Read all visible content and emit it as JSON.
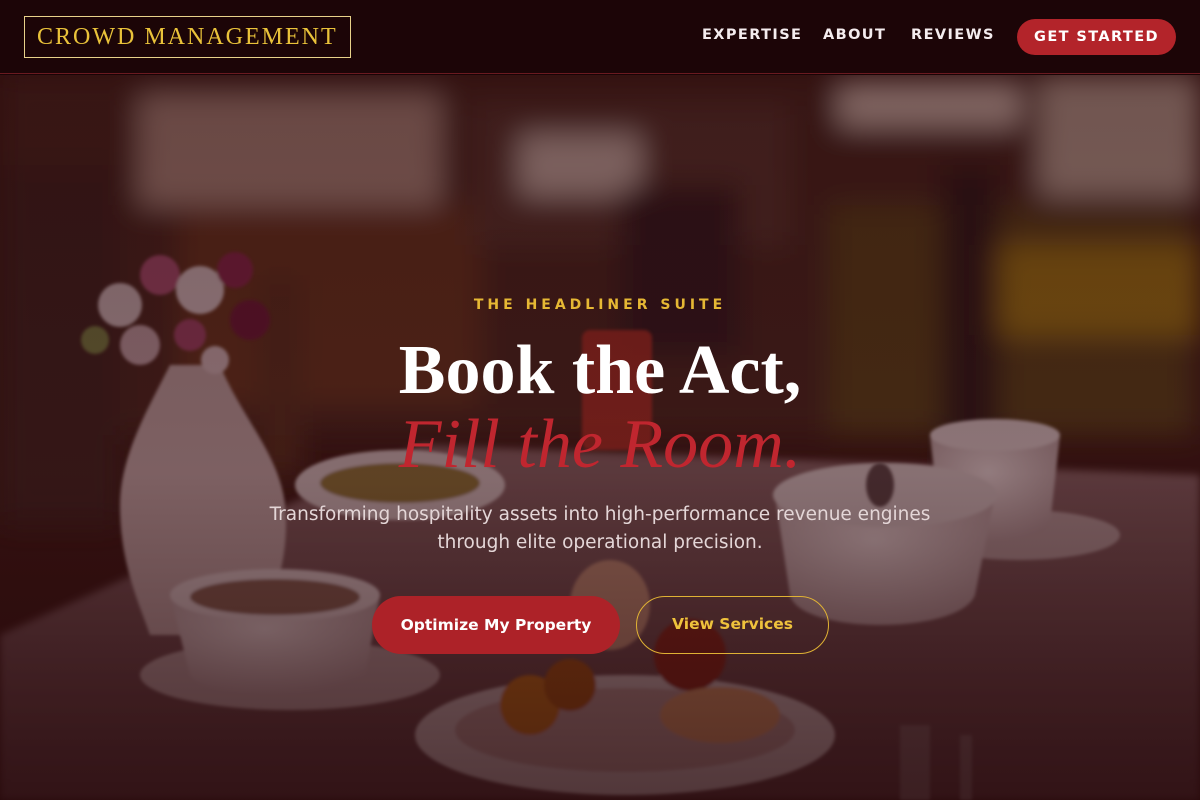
{
  "brand": {
    "logo_text": "CROWD MANAGEMENT"
  },
  "nav": {
    "links": [
      {
        "label": "EXPERTISE"
      },
      {
        "label": "ABOUT"
      },
      {
        "label": "REVIEWS"
      }
    ],
    "cta_label": "GET STARTED"
  },
  "hero": {
    "eyebrow": "THE HEADLINER SUITE",
    "headline_line1": "Book the Act,",
    "headline_line2": "Fill the Room.",
    "subtitle": "Transforming hospitality assets into high-performance revenue engines through elite operational precision.",
    "primary_button": "Optimize My Property",
    "secondary_button": "View Services",
    "background_image": "restaurant-breakfast-table-photo"
  },
  "colors": {
    "nav_bg": "#1c0507",
    "accent_red": "#b3242a",
    "accent_gold": "#e9c23a",
    "headline_red": "#c0262f",
    "text_light": "#e4d6d7"
  }
}
